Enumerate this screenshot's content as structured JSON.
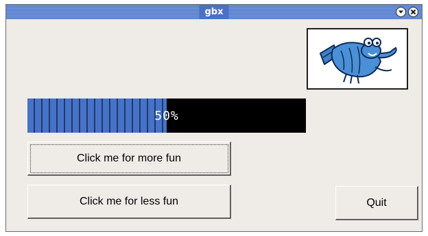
{
  "window": {
    "title": "gbx",
    "controls": [
      {
        "name": "minimize",
        "icon": "chevron-down-icon"
      },
      {
        "name": "close",
        "icon": "close-icon"
      }
    ]
  },
  "logo": {
    "icon": "shrimp-mascot-icon"
  },
  "progress": {
    "value": 0.5,
    "label": "50%"
  },
  "buttons": {
    "more_fun": "Click me for more fun",
    "less_fun": "Click me for less fun",
    "quit": "Quit"
  },
  "colors": {
    "titlebar": "#4a71c4",
    "progress_fill": "#4673c7",
    "progress_track": "#000000",
    "window_bg": "#efebe7"
  }
}
